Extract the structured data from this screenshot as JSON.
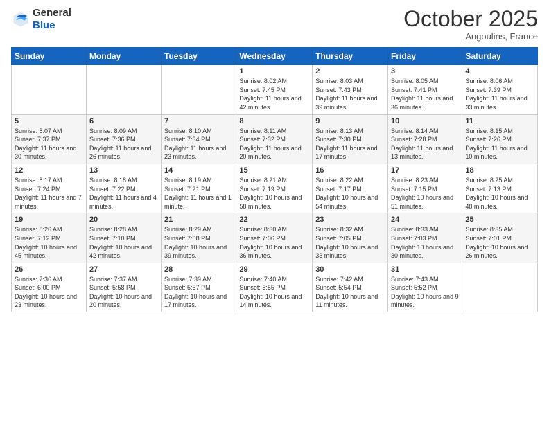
{
  "header": {
    "logo_line1": "General",
    "logo_line2": "Blue",
    "month": "October 2025",
    "location": "Angoulins, France"
  },
  "weekdays": [
    "Sunday",
    "Monday",
    "Tuesday",
    "Wednesday",
    "Thursday",
    "Friday",
    "Saturday"
  ],
  "weeks": [
    [
      {
        "day": "",
        "sunrise": "",
        "sunset": "",
        "daylight": ""
      },
      {
        "day": "",
        "sunrise": "",
        "sunset": "",
        "daylight": ""
      },
      {
        "day": "",
        "sunrise": "",
        "sunset": "",
        "daylight": ""
      },
      {
        "day": "1",
        "sunrise": "Sunrise: 8:02 AM",
        "sunset": "Sunset: 7:45 PM",
        "daylight": "Daylight: 11 hours and 42 minutes."
      },
      {
        "day": "2",
        "sunrise": "Sunrise: 8:03 AM",
        "sunset": "Sunset: 7:43 PM",
        "daylight": "Daylight: 11 hours and 39 minutes."
      },
      {
        "day": "3",
        "sunrise": "Sunrise: 8:05 AM",
        "sunset": "Sunset: 7:41 PM",
        "daylight": "Daylight: 11 hours and 36 minutes."
      },
      {
        "day": "4",
        "sunrise": "Sunrise: 8:06 AM",
        "sunset": "Sunset: 7:39 PM",
        "daylight": "Daylight: 11 hours and 33 minutes."
      }
    ],
    [
      {
        "day": "5",
        "sunrise": "Sunrise: 8:07 AM",
        "sunset": "Sunset: 7:37 PM",
        "daylight": "Daylight: 11 hours and 30 minutes."
      },
      {
        "day": "6",
        "sunrise": "Sunrise: 8:09 AM",
        "sunset": "Sunset: 7:36 PM",
        "daylight": "Daylight: 11 hours and 26 minutes."
      },
      {
        "day": "7",
        "sunrise": "Sunrise: 8:10 AM",
        "sunset": "Sunset: 7:34 PM",
        "daylight": "Daylight: 11 hours and 23 minutes."
      },
      {
        "day": "8",
        "sunrise": "Sunrise: 8:11 AM",
        "sunset": "Sunset: 7:32 PM",
        "daylight": "Daylight: 11 hours and 20 minutes."
      },
      {
        "day": "9",
        "sunrise": "Sunrise: 8:13 AM",
        "sunset": "Sunset: 7:30 PM",
        "daylight": "Daylight: 11 hours and 17 minutes."
      },
      {
        "day": "10",
        "sunrise": "Sunrise: 8:14 AM",
        "sunset": "Sunset: 7:28 PM",
        "daylight": "Daylight: 11 hours and 13 minutes."
      },
      {
        "day": "11",
        "sunrise": "Sunrise: 8:15 AM",
        "sunset": "Sunset: 7:26 PM",
        "daylight": "Daylight: 11 hours and 10 minutes."
      }
    ],
    [
      {
        "day": "12",
        "sunrise": "Sunrise: 8:17 AM",
        "sunset": "Sunset: 7:24 PM",
        "daylight": "Daylight: 11 hours and 7 minutes."
      },
      {
        "day": "13",
        "sunrise": "Sunrise: 8:18 AM",
        "sunset": "Sunset: 7:22 PM",
        "daylight": "Daylight: 11 hours and 4 minutes."
      },
      {
        "day": "14",
        "sunrise": "Sunrise: 8:19 AM",
        "sunset": "Sunset: 7:21 PM",
        "daylight": "Daylight: 11 hours and 1 minute."
      },
      {
        "day": "15",
        "sunrise": "Sunrise: 8:21 AM",
        "sunset": "Sunset: 7:19 PM",
        "daylight": "Daylight: 10 hours and 58 minutes."
      },
      {
        "day": "16",
        "sunrise": "Sunrise: 8:22 AM",
        "sunset": "Sunset: 7:17 PM",
        "daylight": "Daylight: 10 hours and 54 minutes."
      },
      {
        "day": "17",
        "sunrise": "Sunrise: 8:23 AM",
        "sunset": "Sunset: 7:15 PM",
        "daylight": "Daylight: 10 hours and 51 minutes."
      },
      {
        "day": "18",
        "sunrise": "Sunrise: 8:25 AM",
        "sunset": "Sunset: 7:13 PM",
        "daylight": "Daylight: 10 hours and 48 minutes."
      }
    ],
    [
      {
        "day": "19",
        "sunrise": "Sunrise: 8:26 AM",
        "sunset": "Sunset: 7:12 PM",
        "daylight": "Daylight: 10 hours and 45 minutes."
      },
      {
        "day": "20",
        "sunrise": "Sunrise: 8:28 AM",
        "sunset": "Sunset: 7:10 PM",
        "daylight": "Daylight: 10 hours and 42 minutes."
      },
      {
        "day": "21",
        "sunrise": "Sunrise: 8:29 AM",
        "sunset": "Sunset: 7:08 PM",
        "daylight": "Daylight: 10 hours and 39 minutes."
      },
      {
        "day": "22",
        "sunrise": "Sunrise: 8:30 AM",
        "sunset": "Sunset: 7:06 PM",
        "daylight": "Daylight: 10 hours and 36 minutes."
      },
      {
        "day": "23",
        "sunrise": "Sunrise: 8:32 AM",
        "sunset": "Sunset: 7:05 PM",
        "daylight": "Daylight: 10 hours and 33 minutes."
      },
      {
        "day": "24",
        "sunrise": "Sunrise: 8:33 AM",
        "sunset": "Sunset: 7:03 PM",
        "daylight": "Daylight: 10 hours and 30 minutes."
      },
      {
        "day": "25",
        "sunrise": "Sunrise: 8:35 AM",
        "sunset": "Sunset: 7:01 PM",
        "daylight": "Daylight: 10 hours and 26 minutes."
      }
    ],
    [
      {
        "day": "26",
        "sunrise": "Sunrise: 7:36 AM",
        "sunset": "Sunset: 6:00 PM",
        "daylight": "Daylight: 10 hours and 23 minutes."
      },
      {
        "day": "27",
        "sunrise": "Sunrise: 7:37 AM",
        "sunset": "Sunset: 5:58 PM",
        "daylight": "Daylight: 10 hours and 20 minutes."
      },
      {
        "day": "28",
        "sunrise": "Sunrise: 7:39 AM",
        "sunset": "Sunset: 5:57 PM",
        "daylight": "Daylight: 10 hours and 17 minutes."
      },
      {
        "day": "29",
        "sunrise": "Sunrise: 7:40 AM",
        "sunset": "Sunset: 5:55 PM",
        "daylight": "Daylight: 10 hours and 14 minutes."
      },
      {
        "day": "30",
        "sunrise": "Sunrise: 7:42 AM",
        "sunset": "Sunset: 5:54 PM",
        "daylight": "Daylight: 10 hours and 11 minutes."
      },
      {
        "day": "31",
        "sunrise": "Sunrise: 7:43 AM",
        "sunset": "Sunset: 5:52 PM",
        "daylight": "Daylight: 10 hours and 9 minutes."
      },
      {
        "day": "",
        "sunrise": "",
        "sunset": "",
        "daylight": ""
      }
    ]
  ]
}
